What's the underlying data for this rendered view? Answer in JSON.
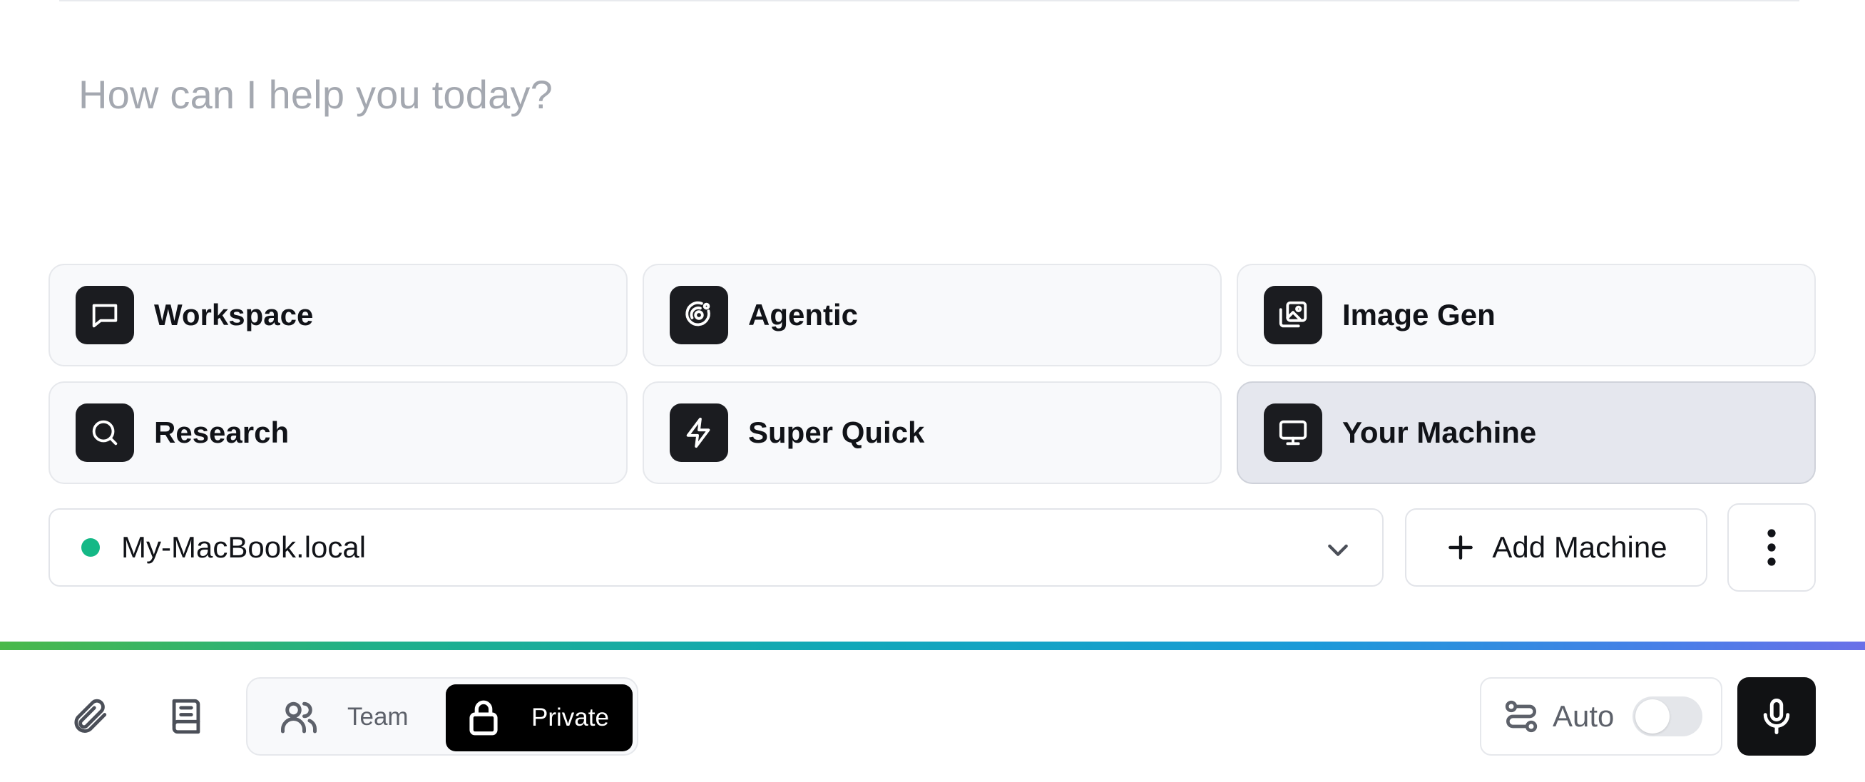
{
  "composer": {
    "placeholder": "How can I help you today?"
  },
  "modes": [
    {
      "label": "Workspace",
      "icon": "chat-bubble-icon",
      "selected": false
    },
    {
      "label": "Agentic",
      "icon": "orbit-icon",
      "selected": false
    },
    {
      "label": "Image Gen",
      "icon": "images-icon",
      "selected": false
    },
    {
      "label": "Research",
      "icon": "search-icon",
      "selected": false
    },
    {
      "label": "Super Quick",
      "icon": "lightning-icon",
      "selected": false
    },
    {
      "label": "Your Machine",
      "icon": "monitor-icon",
      "selected": true
    }
  ],
  "machine": {
    "selected": "My-MacBook.local",
    "status": "online",
    "status_color": "#14b886",
    "add_label": "Add Machine"
  },
  "toolbar": {
    "visibility": {
      "team_label": "Team",
      "private_label": "Private",
      "selected": "Private"
    },
    "auto_label": "Auto",
    "auto_enabled": false
  },
  "colors": {
    "accent_dark": "#111214",
    "gradient": [
      "#4ab84a",
      "#10a8b8",
      "#6a70e8"
    ]
  }
}
